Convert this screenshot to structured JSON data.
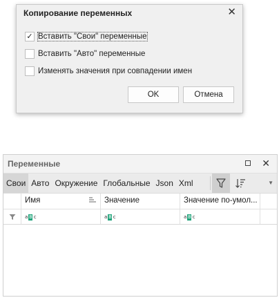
{
  "dialog": {
    "title": "Копирование переменных",
    "options": [
      {
        "label": "Вставить \"Свои\" переменные",
        "checked": true
      },
      {
        "label": "Вставить \"Авто\" переменные",
        "checked": false
      },
      {
        "label": "Изменять значения при совпадении имен",
        "checked": false
      }
    ],
    "ok_label": "OK",
    "cancel_label": "Отмена",
    "check_mark": "✓",
    "close_glyph": "✕"
  },
  "panel": {
    "title": "Переменные",
    "close_glyph": "✕",
    "tabs": [
      {
        "label": "Свои",
        "active": true
      },
      {
        "label": "Авто"
      },
      {
        "label": "Окружение"
      },
      {
        "label": "Глобальные"
      },
      {
        "label": "Json"
      },
      {
        "label": "Xml"
      }
    ],
    "columns": [
      {
        "label": "Имя"
      },
      {
        "label": "Значение"
      },
      {
        "label": "Значение по-умол..."
      }
    ],
    "filter_cell_text": {
      "a": "a",
      "b": "B",
      "c": "c"
    },
    "colors": {
      "accent_green": "#1fa37a"
    }
  }
}
